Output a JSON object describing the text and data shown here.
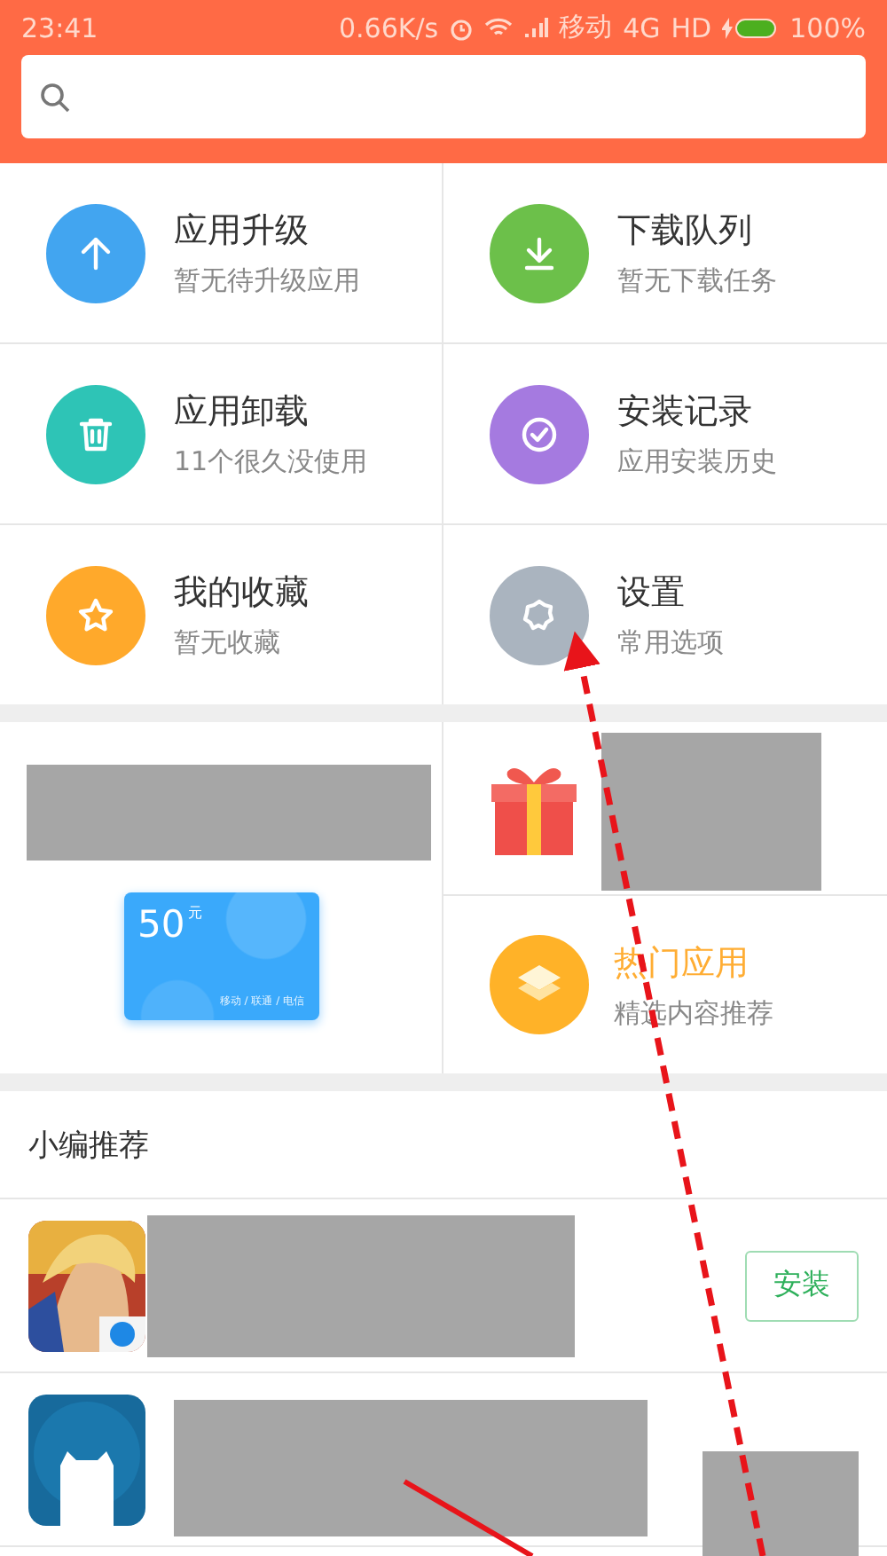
{
  "status_bar": {
    "time": "23:41",
    "speed": "0.66K/s",
    "carrier": "移动",
    "network": "4G",
    "hd": "HD",
    "battery": "100%"
  },
  "tools": [
    {
      "title": "应用升级",
      "subtitle": "暂无待升级应用",
      "kind": "upgrade",
      "color": "#42a5f0"
    },
    {
      "title": "下载队列",
      "subtitle": "暂无下载任务",
      "kind": "download",
      "color": "#6cc04a"
    },
    {
      "title": "应用卸载",
      "subtitle": "11个很久没使用",
      "kind": "uninstall",
      "color": "#2ec4b6"
    },
    {
      "title": "安装记录",
      "subtitle": "应用安装历史",
      "kind": "history",
      "color": "#a57ae0"
    },
    {
      "title": "我的收藏",
      "subtitle": "暂无收藏",
      "kind": "favorite",
      "color": "#ffa92b"
    },
    {
      "title": "设置",
      "subtitle": "常用选项",
      "kind": "settings",
      "color": "#aab4bf"
    }
  ],
  "promo": {
    "card_amount": "50",
    "card_unit": "元",
    "card_note": "移动 / 联通 / 电信",
    "hot_title": "热门应用",
    "hot_subtitle": "精选内容推荐"
  },
  "recommend": {
    "title": "小编推荐",
    "apps": [
      {
        "kind": "game",
        "button": "安装"
      },
      {
        "kind": "cat"
      }
    ]
  }
}
